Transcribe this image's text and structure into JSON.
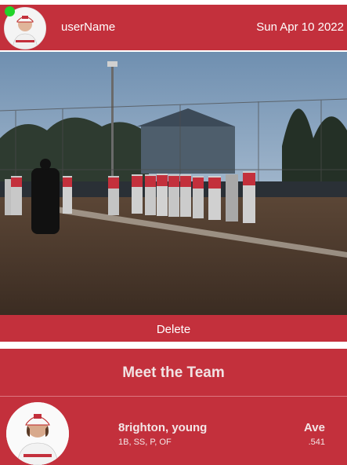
{
  "post": {
    "username": "userName",
    "date": "Sun Apr 10 2022",
    "delete_label": "Delete"
  },
  "team": {
    "title": "Meet the Team",
    "players": [
      {
        "name": "8righton, young",
        "positions": "1B, SS, P, OF",
        "stat_label": "Ave",
        "stat_value": ".541"
      }
    ]
  },
  "colors": {
    "brand_red": "#c3303c",
    "online": "#22d42a"
  },
  "icons": {
    "avatar": "player-avatar-icon",
    "online": "online-status-icon"
  }
}
